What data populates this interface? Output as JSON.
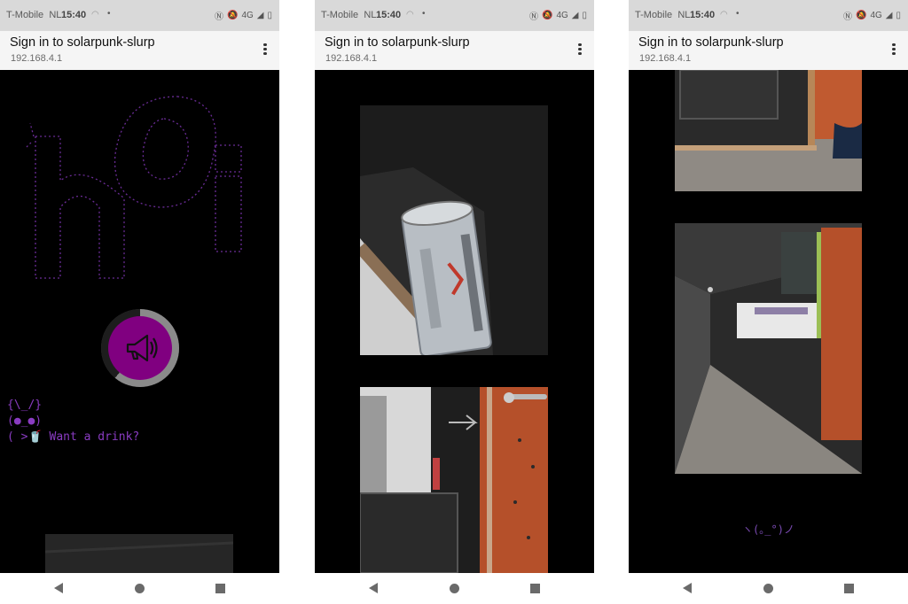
{
  "status_bar": {
    "carrier": "T-Mobile",
    "region": "NL",
    "time": "15:40",
    "network": "4G"
  },
  "header": {
    "title": "Sign in to solarpunk-slurp",
    "address": "192.168.4.1"
  },
  "screen1": {
    "ascii_banner_lines": [
      "           .-''''-.",
      "          /  _.._  \\      __",
      "  .'      |  /    \\ |   .'  `.",
      "  /  ,   |  |    | |   |  /",
      " |   |   \\  '.__.' /   |  |",
      " |   |    '.____.'     |  |",
      " |   |.''-..            |  |",
      " |   |    |  |          |__|",
      " |   |    |  |",
      " |   |    |  |",
      " '---'    '--'"
    ],
    "terminal_lines": [
      "{\\_/}",
      "(●_●)",
      "( >🥤 Want a drink?"
    ],
    "horn_button_icon": "megaphone-icon"
  },
  "screen3": {
    "kaomoji": "ヽ(｡_°)ノ"
  },
  "colors": {
    "accent": "#800080",
    "ascii": "#6a2c96",
    "status_bar": "#d9d9d9",
    "header": "#f5f5f5",
    "content_bg": "#000000"
  }
}
